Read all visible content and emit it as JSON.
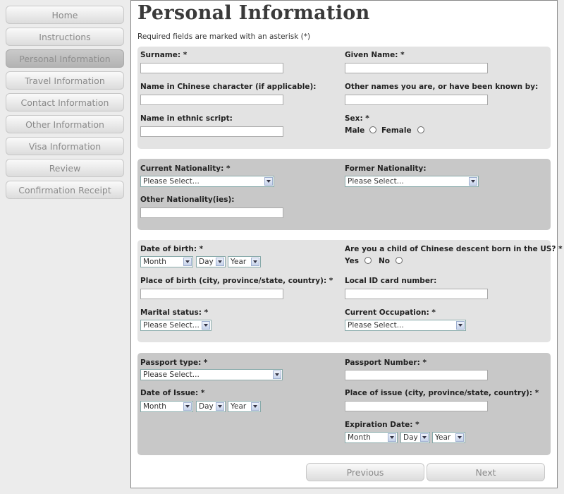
{
  "nav": {
    "items": [
      {
        "label": "Home"
      },
      {
        "label": "Instructions"
      },
      {
        "label": "Personal Information",
        "active": true
      },
      {
        "label": "Travel Information"
      },
      {
        "label": "Contact Information"
      },
      {
        "label": "Other Information"
      },
      {
        "label": "Visa Information"
      },
      {
        "label": "Review"
      },
      {
        "label": "Confirmation Receipt"
      }
    ]
  },
  "page": {
    "title": "Personal Information",
    "subtitle": "Required fields are marked with an asterisk (*)"
  },
  "section1": {
    "surname_label": "Surname: *",
    "given_name_label": "Given Name: *",
    "chinese_name_label": "Name in Chinese character (if applicable):",
    "other_names_label": "Other names you are, or have been known by:",
    "ethnic_name_label": "Name in ethnic script:",
    "sex_label": "Sex: *",
    "male_label": "Male",
    "female_label": "Female"
  },
  "section2": {
    "current_nationality_label": "Current Nationality: *",
    "current_nationality_value": "Please Select...",
    "former_nationality_label": "Former Nationality:",
    "former_nationality_value": "Please Select...",
    "other_nationalities_label": "Other Nationality(ies):"
  },
  "section3": {
    "dob_label": "Date of birth: *",
    "dob_month": "Month",
    "dob_day": "Day",
    "dob_year": "Year",
    "child_label": "Are you a child of Chinese descent born in the US? *",
    "yes_label": "Yes",
    "no_label": "No",
    "pob_label": "Place of birth (city, province/state, country): *",
    "local_id_label": "Local ID card number:",
    "marital_label": "Marital status: *",
    "marital_value": "Please Select...",
    "occupation_label": "Current Occupation: *",
    "occupation_value": "Please Select..."
  },
  "section4": {
    "passport_type_label": "Passport type: *",
    "passport_type_value": "Please Select...",
    "passport_number_label": "Passport Number: *",
    "issue_date_label": "Date of Issue: *",
    "issue_month": "Month",
    "issue_day": "Day",
    "issue_year": "Year",
    "place_issue_label": "Place of issue (city, province/state, country): *",
    "expiration_label": "Expiration Date: *",
    "exp_month": "Month",
    "exp_day": "Day",
    "exp_year": "Year"
  },
  "buttons": {
    "previous": "Previous",
    "next": "Next"
  }
}
